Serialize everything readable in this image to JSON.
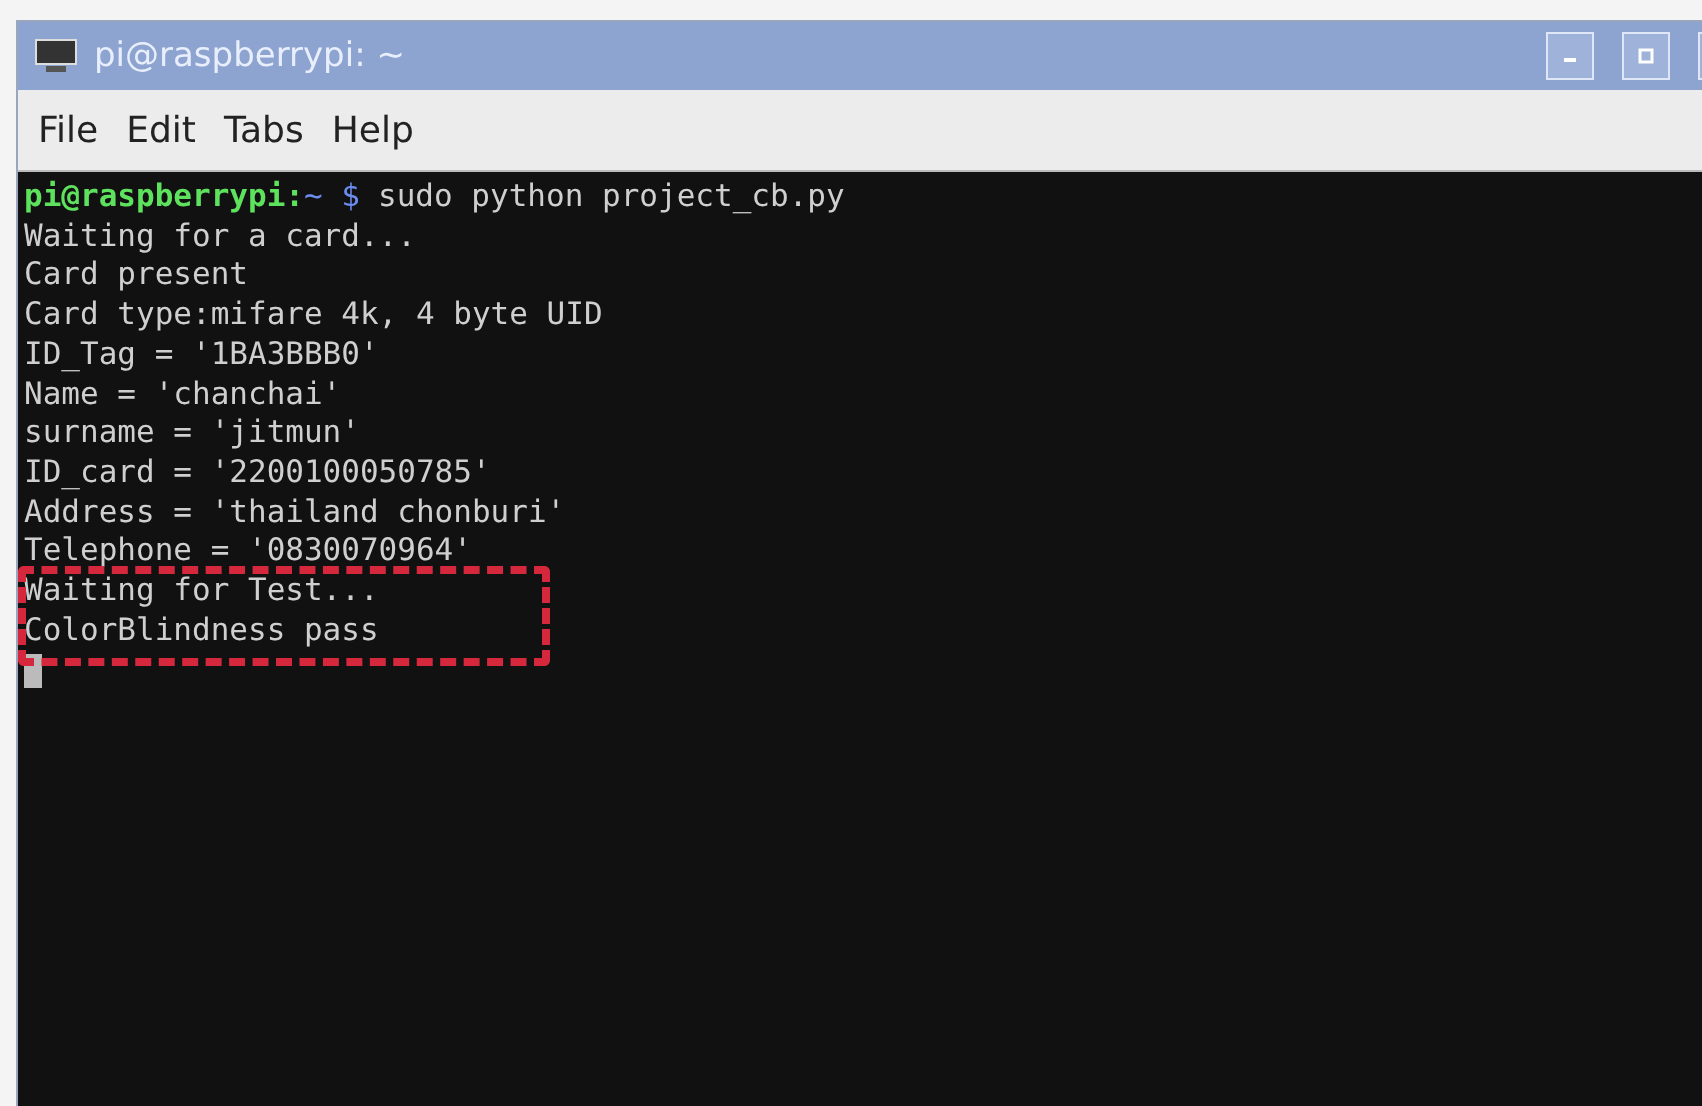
{
  "window": {
    "title": "pi@raspberrypi: ~"
  },
  "menu": [
    "File",
    "Edit",
    "Tabs",
    "Help"
  ],
  "terminal": {
    "prompt": {
      "user": "pi@raspberrypi:",
      "path": "~",
      "symbol": "$"
    },
    "command": "sudo python project_cb.py",
    "lines": [
      {
        "text": "Waiting for a card...",
        "highlighted": false
      },
      {
        "text": "Card present",
        "highlighted": false
      },
      {
        "text": "Card type:mifare 4k, 4 byte UID",
        "highlighted": false
      },
      {
        "text": "ID_Tag = '1BA3BBB0'",
        "highlighted": false
      },
      {
        "text": "Name = 'chanchai'",
        "highlighted": false
      },
      {
        "text": "surname = 'jitmun'",
        "highlighted": false
      },
      {
        "text": "ID_card = '2200100050785'",
        "highlighted": false
      },
      {
        "text": "Address = 'thailand chonburi'",
        "highlighted": false
      },
      {
        "text": "Telephone = '0830070964'",
        "highlighted": false
      },
      {
        "text": "Waiting for Test...",
        "highlighted": true
      },
      {
        "text": "ColorBlindness pass",
        "highlighted": true
      }
    ]
  }
}
